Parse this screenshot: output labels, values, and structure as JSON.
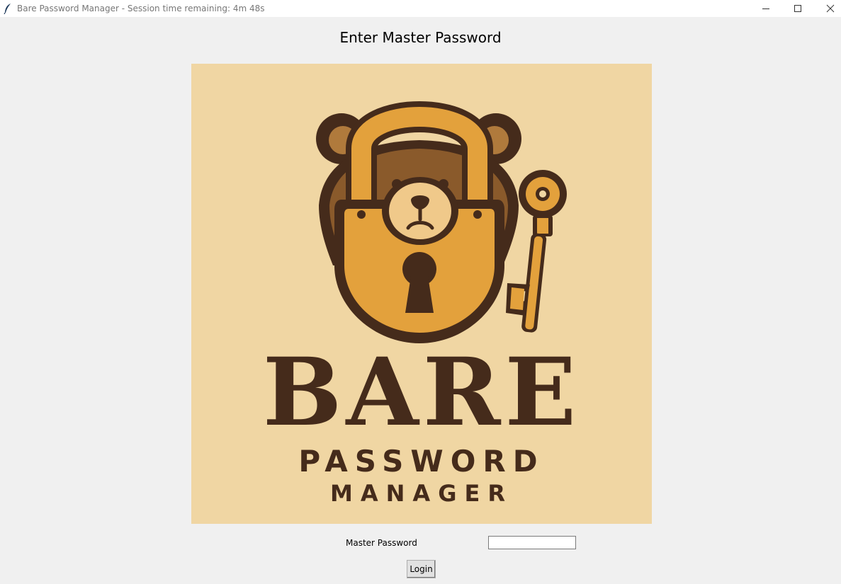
{
  "window": {
    "title": "Bare Password Manager - Session time remaining: 4m 48s",
    "controls": {
      "minimize": "minimize",
      "maximize": "maximize",
      "close": "close"
    }
  },
  "main": {
    "heading": "Enter Master Password",
    "logo": {
      "line1": "BARE",
      "line2": "PASSWORD",
      "line3": "MANAGER",
      "icons": [
        "bear-icon",
        "padlock-icon",
        "key-icon"
      ]
    },
    "form": {
      "password_label": "Master Password",
      "password_value": "",
      "login_label": "Login"
    }
  },
  "colors": {
    "window_bg": "#f0f0f0",
    "logo_bg": "#f0d6a3",
    "logo_dark": "#452b1b",
    "logo_gold": "#e3a13c",
    "bear_brown": "#8a5a2b"
  }
}
